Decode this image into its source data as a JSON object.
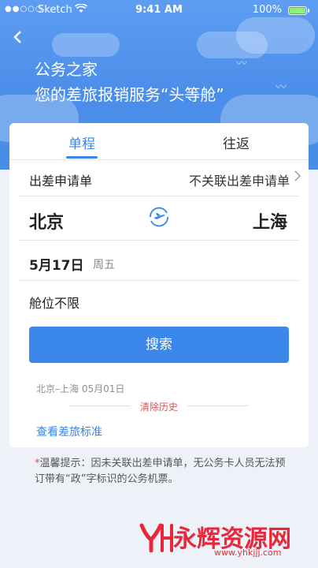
{
  "status_bar": {
    "carrier": "Sketch",
    "time": "9:41 AM",
    "battery": "100%"
  },
  "header": {
    "back_icon": "chevron-left-icon",
    "title_line1": "公务之家",
    "title_line2": "您的差旅报销服务“头等舱”"
  },
  "tabs": [
    {
      "label": "单程",
      "active": true
    },
    {
      "label": "往返",
      "active": false
    }
  ],
  "apply_row": {
    "label": "出差申请单",
    "value": "不关联出差申请单"
  },
  "route": {
    "from": "北京",
    "to": "上海",
    "swap_icon": "plane-swap-icon"
  },
  "date": {
    "date": "5月17日",
    "weekday": "周五"
  },
  "cabin": "舱位不限",
  "search_button": "搜索",
  "history": {
    "item": "北京–上海 05月01日",
    "clear": "清除历史"
  },
  "travel_standard_link": "查看差旅标准",
  "tip": {
    "star": "*",
    "text": "温馨提示：因未关联出差申请单，无公务卡人员无法预订带有“政”字标识的公务机票。"
  },
  "watermark": {
    "text": "永辉资源网",
    "url": "www.yhkjjj.com"
  },
  "colors": {
    "accent": "#3a86e8",
    "header_bg": "#4b8eea",
    "warning": "#e05252"
  }
}
